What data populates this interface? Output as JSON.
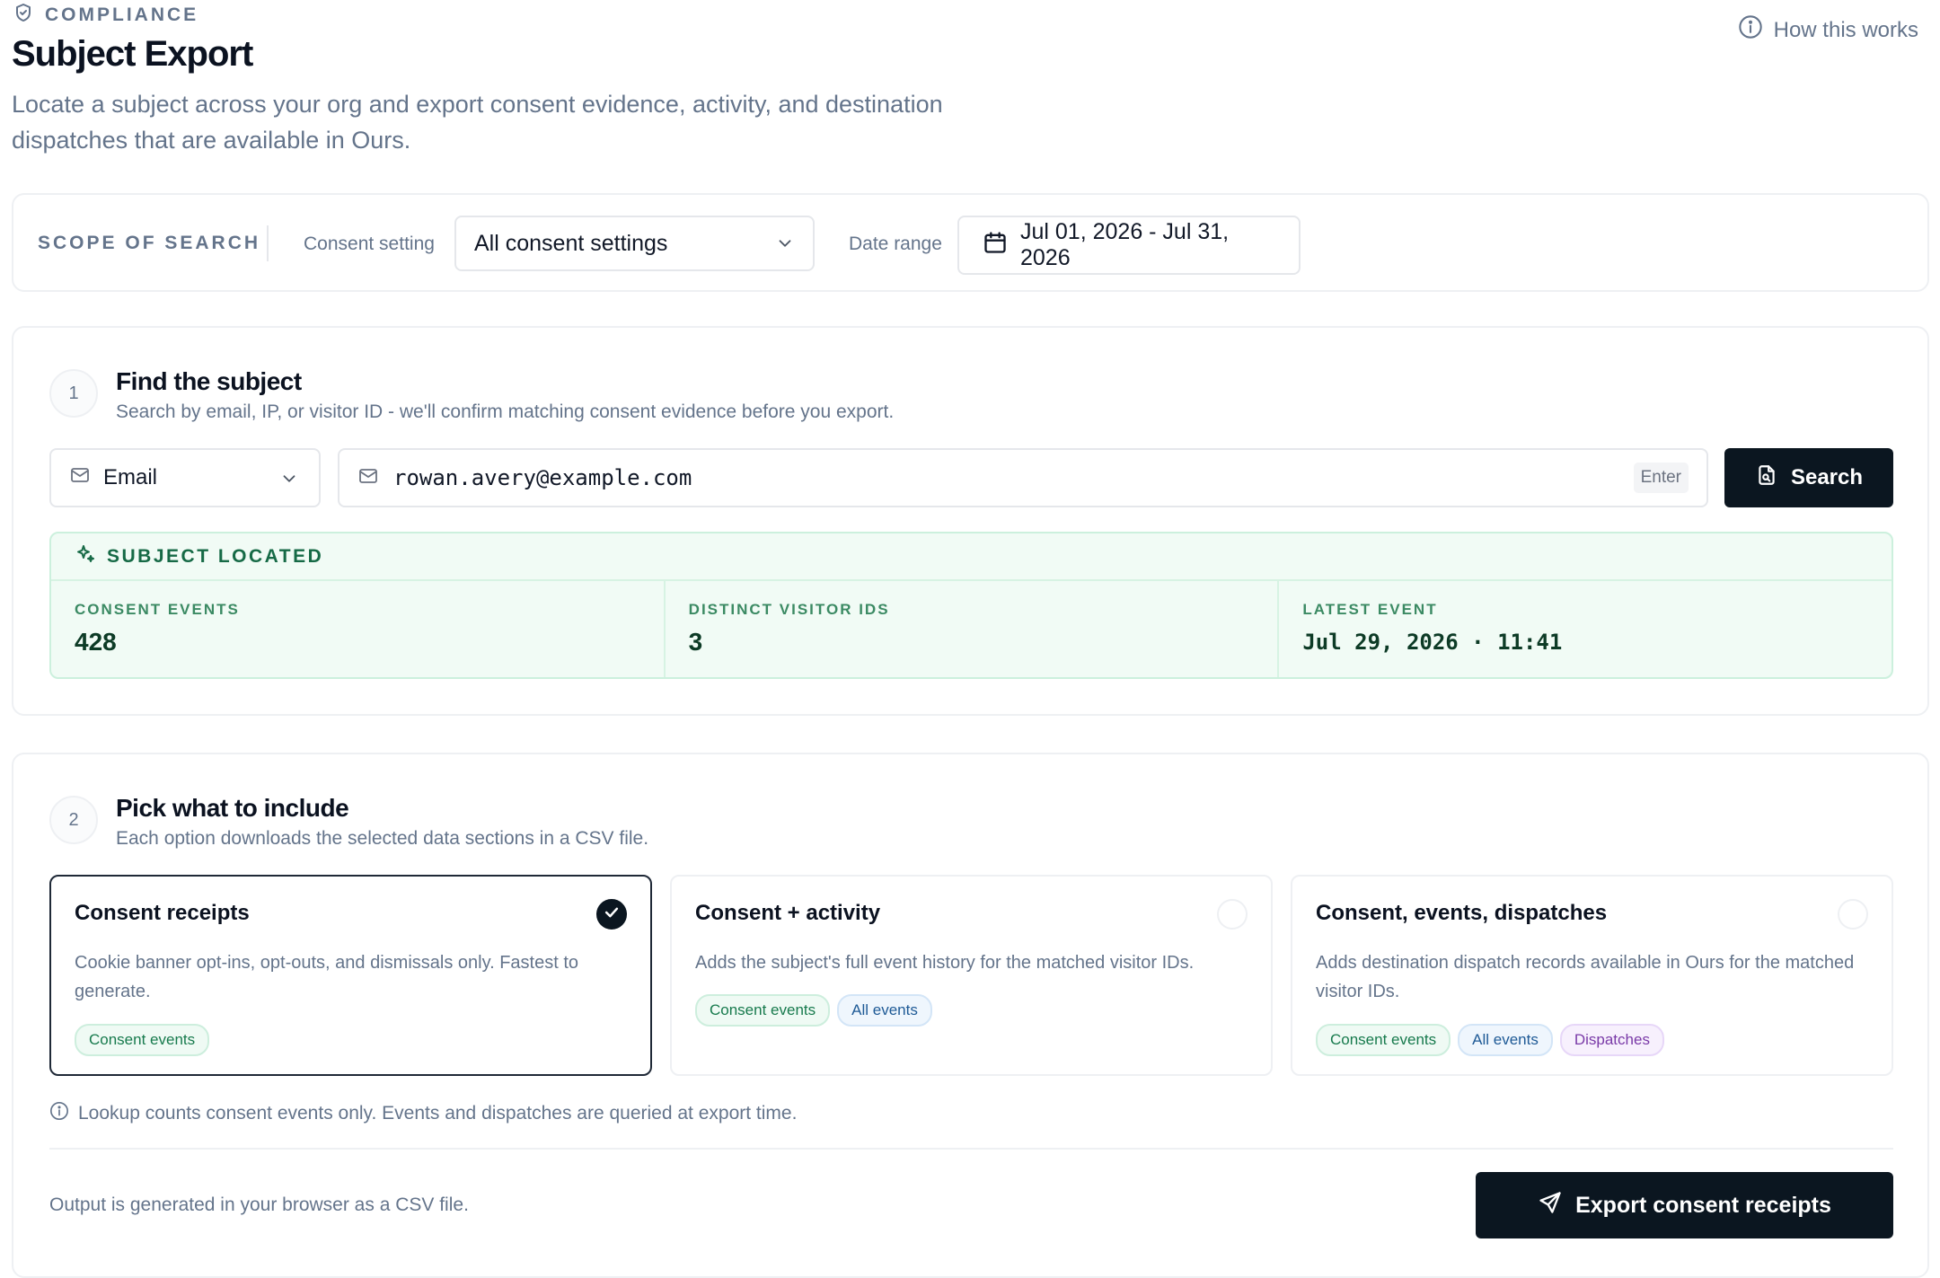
{
  "header": {
    "eyebrow": "COMPLIANCE",
    "title": "Subject Export",
    "description": "Locate a subject across your org and export consent evidence, activity, and destination dispatches that are available in Ours.",
    "help_link": "How this works"
  },
  "scope": {
    "title": "SCOPE OF SEARCH",
    "consent_label": "Consent setting",
    "consent_value": "All consent settings",
    "date_label": "Date range",
    "date_value": "Jul 01, 2026 - Jul 31, 2026"
  },
  "find": {
    "step": "1",
    "title": "Find the subject",
    "subtitle": "Search by email, IP, or visitor ID - we'll confirm matching consent evidence before you export.",
    "id_type": "Email",
    "query": "rowan.avery@example.com",
    "enter_hint": "Enter",
    "search_label": "Search",
    "located": {
      "title": "SUBJECT LOCATED",
      "stats": [
        {
          "label": "CONSENT EVENTS",
          "value": "428"
        },
        {
          "label": "DISTINCT VISITOR IDS",
          "value": "3"
        },
        {
          "label": "LATEST EVENT",
          "value": "Jul 29, 2026 · 11:41"
        }
      ]
    }
  },
  "pick": {
    "step": "2",
    "title": "Pick what to include",
    "subtitle": "Each option downloads the selected data sections in a CSV file.",
    "options": [
      {
        "title": "Consent receipts",
        "description": "Cookie banner opt-ins, opt-outs, and dismissals only. Fastest to generate.",
        "selected": true,
        "tags": [
          "Consent events"
        ]
      },
      {
        "title": "Consent + activity",
        "description": "Adds the subject's full event history for the matched visitor IDs.",
        "selected": false,
        "tags": [
          "Consent events",
          "All events"
        ]
      },
      {
        "title": "Consent, events, dispatches",
        "description": "Adds destination dispatch records available in Ours for the matched visitor IDs.",
        "selected": false,
        "tags": [
          "Consent events",
          "All events",
          "Dispatches"
        ]
      }
    ],
    "note": "Lookup counts consent events only. Events and dispatches are queried at export time.",
    "output_text": "Output is generated in your browser as a CSV file.",
    "export_label": "Export consent receipts"
  }
}
